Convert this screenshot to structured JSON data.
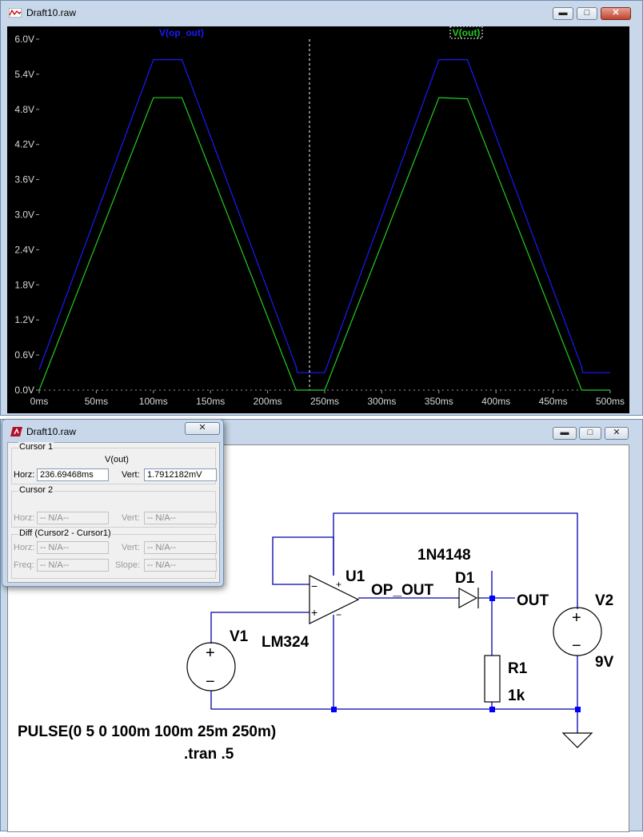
{
  "plot_window": {
    "title": "Draft10.raw",
    "buttons": {
      "minimize": "▬",
      "maximize": "□",
      "close": "✕"
    }
  },
  "schematic_window": {
    "buttons": {
      "minimize": "▬",
      "maximize": "□",
      "close": "✕"
    }
  },
  "chart_data": {
    "type": "line",
    "background": "#000000",
    "xlim": [
      0,
      500
    ],
    "ylim": [
      0,
      6.0
    ],
    "x_ticks": [
      "0ms",
      "50ms",
      "100ms",
      "150ms",
      "200ms",
      "250ms",
      "300ms",
      "350ms",
      "400ms",
      "450ms",
      "500ms"
    ],
    "y_ticks": [
      "0.0V",
      "0.6V",
      "1.2V",
      "1.8V",
      "2.4V",
      "3.0V",
      "3.6V",
      "4.2V",
      "4.8V",
      "5.4V",
      "6.0V"
    ],
    "cursor_x": 236.7,
    "series": [
      {
        "name": "V(op_out)",
        "color": "#1a1aff",
        "x": [
          0,
          100,
          125,
          225,
          226,
          250,
          350,
          375,
          475,
          476,
          500
        ],
        "y": [
          0.35,
          5.65,
          5.65,
          0.4,
          0.3,
          0.3,
          5.65,
          5.65,
          0.4,
          0.3,
          0.3
        ]
      },
      {
        "name": "V(out)",
        "color": "#22cc22",
        "x": [
          0,
          100,
          125,
          225,
          250,
          350,
          375,
          475,
          500
        ],
        "y": [
          0,
          5.0,
          5.0,
          0,
          0,
          5.0,
          4.98,
          0,
          0
        ]
      }
    ]
  },
  "cursor_dialog": {
    "title": "Draft10.raw",
    "close": "✕",
    "cursor1": {
      "group_label": "Cursor 1",
      "trace": "V(out)",
      "horz_label": "Horz:",
      "horz": "236.69468ms",
      "vert_label": "Vert:",
      "vert": "1.7912182mV"
    },
    "cursor2": {
      "group_label": "Cursor 2",
      "horz_label": "Horz:",
      "horz": "-- N/A--",
      "vert_label": "Vert:",
      "vert": "-- N/A--"
    },
    "diff": {
      "group_label": "Diff (Cursor2 - Cursor1)",
      "horz_label": "Horz:",
      "horz": "-- N/A--",
      "vert_label": "Vert:",
      "vert": "-- N/A--",
      "freq_label": "Freq:",
      "freq": "-- N/A--",
      "slope_label": "Slope:",
      "slope": "-- N/A--"
    }
  },
  "schematic": {
    "labels": {
      "u1": "U1",
      "lm324": "LM324",
      "v1": "V1",
      "d1": "D1",
      "diode_model": "1N4148",
      "op_out": "OP_OUT",
      "out": "OUT",
      "v2": "V2",
      "v2_value": "9V",
      "r1": "R1",
      "r1_value": "1k",
      "pulse": "PULSE(0 5 0 100m 100m 25m 250m)",
      "tran": ".tran .5",
      "plus": "+",
      "minus": "−"
    },
    "colors": {
      "wire": "#0000aa",
      "junction": "#0000ff",
      "component": "#000000"
    }
  }
}
